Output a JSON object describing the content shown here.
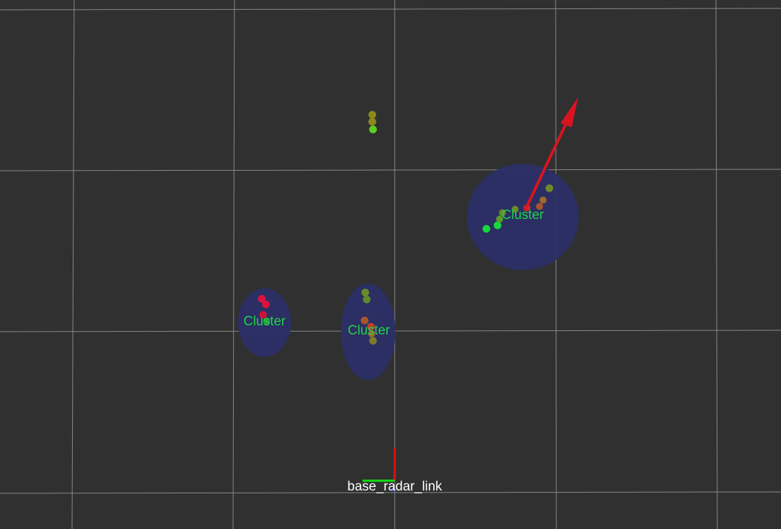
{
  "scene": {
    "background": "#303030",
    "grid_color": "#a0a0a0",
    "cluster_fill": "#2b2f66",
    "cluster_label_color": "#1fd34a",
    "frame_label_color": "#ffffff",
    "arrow_color": "#d9141f"
  },
  "clusters": [
    {
      "label": "Cluster"
    },
    {
      "label": "Cluster"
    },
    {
      "label": "Cluster"
    }
  ],
  "frame": {
    "label": "base_radar_link"
  }
}
